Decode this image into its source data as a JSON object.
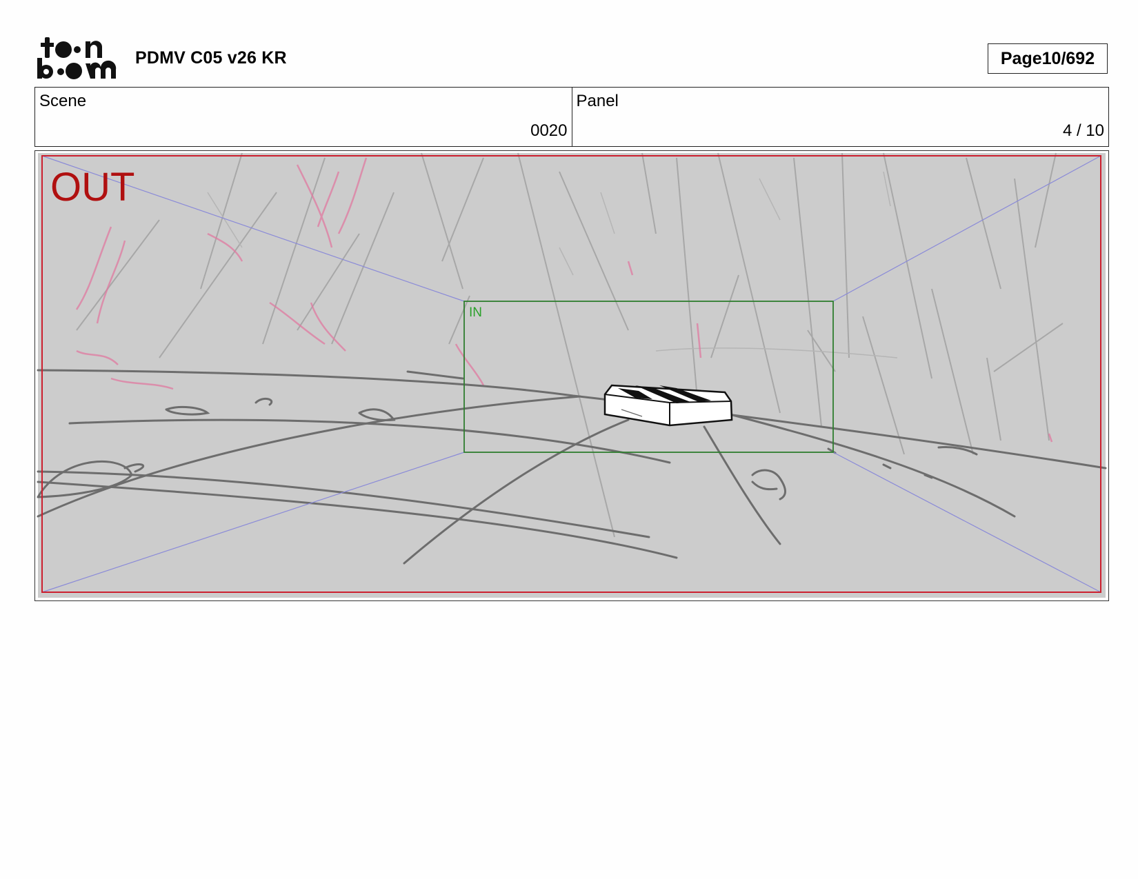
{
  "header": {
    "logo_text": "toon boom",
    "project_title": "PDMV C05 v26 KR",
    "page_label": "Page",
    "page_value": "10/692"
  },
  "info": {
    "scene_label": "Scene",
    "scene_value": "0020",
    "panel_label": "Panel",
    "panel_value": "4 / 10"
  },
  "panel_image": {
    "out_label": "OUT",
    "in_label": "IN",
    "colors": {
      "out_frame": "#cc1f2e",
      "out_text": "#b01010",
      "in_frame": "#2e7d2e",
      "in_text": "#2aa02a",
      "guides": "#8a8ad8",
      "background": "#cccccc",
      "pink_sketch": "#e07aa0"
    }
  }
}
